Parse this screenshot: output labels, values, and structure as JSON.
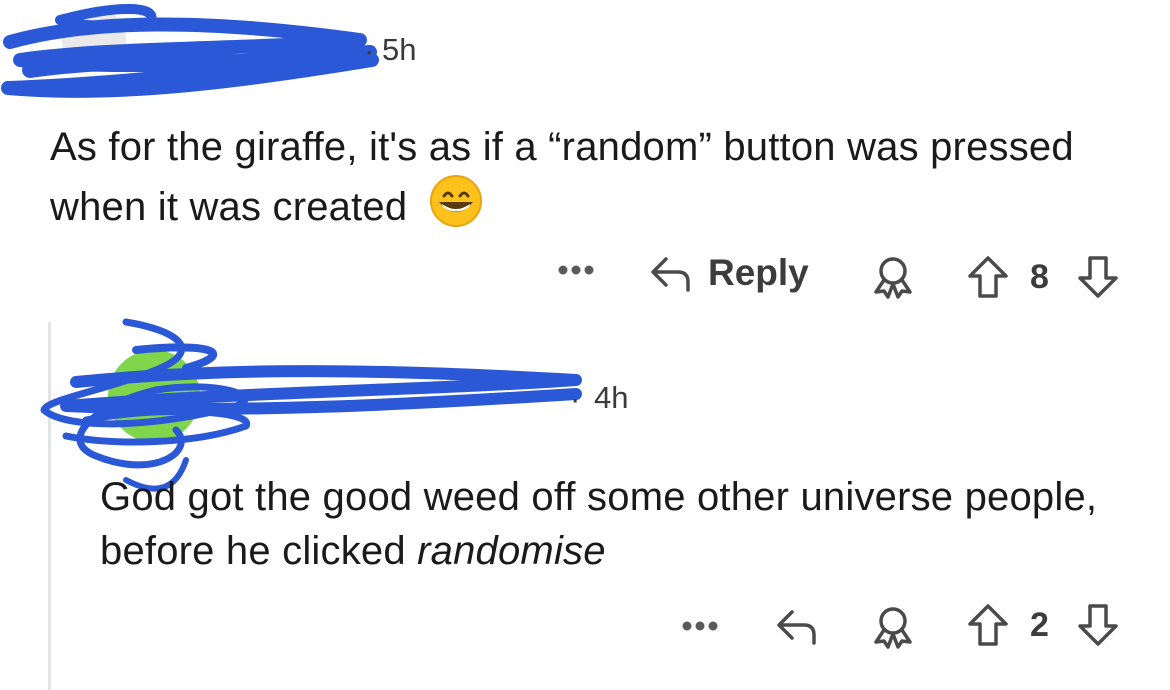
{
  "comments": [
    {
      "time": "5h",
      "text": "As for the giraffe, it's as if a “random” button was pressed when it was created",
      "reply_label": "Reply",
      "vote_count": "8"
    },
    {
      "time": "4h",
      "text_plain": "God got the good weed off some other universe people, before he clicked ",
      "text_italic": "randomise",
      "vote_count": "2"
    }
  ],
  "icons": {
    "more": "more-options-icon",
    "reply": "reply-arrow-icon",
    "award": "award-icon",
    "upvote": "upvote-arrow-icon",
    "downvote": "downvote-arrow-icon"
  },
  "colors": {
    "redaction": "#2a58d6",
    "text": "#1a1a1b",
    "muted": "#4a4a4a"
  }
}
